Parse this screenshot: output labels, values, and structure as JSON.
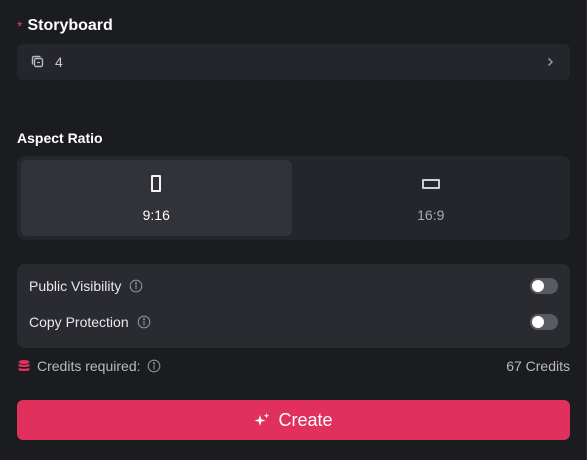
{
  "storyboard": {
    "required_mark": "*",
    "title": "Storyboard",
    "value": "4",
    "icon": "layers-icon"
  },
  "aspect_ratio": {
    "title": "Aspect Ratio",
    "options": [
      {
        "label": "9:16",
        "selected": true
      },
      {
        "label": "16:9",
        "selected": false
      }
    ]
  },
  "settings": {
    "public_visibility": {
      "label": "Public Visibility",
      "enabled": false
    },
    "copy_protection": {
      "label": "Copy Protection",
      "enabled": false
    }
  },
  "credits": {
    "label": "Credits required:",
    "amount": "67 Credits"
  },
  "create_button": {
    "label": "Create"
  },
  "colors": {
    "accent": "#e0305b",
    "background": "#1b1c20",
    "card": "#25262b"
  }
}
